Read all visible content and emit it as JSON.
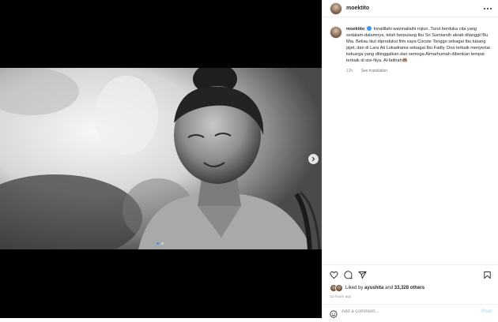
{
  "post": {
    "username": "moektito",
    "caption_username": "moektito",
    "caption_text": "Innalillahi wainnailaihi rojiun. Turut berduka cita yang sedalam-dalamnya, telah berpulang Ibu Sri Sumiarsih akrab dilanggil Bu Mia. Beliau ikut diproduksi film saya Cocote Tonggo sebagai Ibu tukang pijet, dan di Lara Ati Lokadrama sebagai Ibu Fadly. Doa terbaik menyertai keluarga yang ditinggalkan dan semoga Almarhumah dibenkan tempat terbaik di sisi-Nya. Al-fatihah🤲🏽",
    "caption_age": "12h",
    "see_translation": "See translation",
    "liked_by_prefix": "Liked by",
    "liked_by_user": "ayushita",
    "liked_by_and": "and",
    "liked_by_others": "33,328 others",
    "timestamp": "12 hours ago",
    "comment_placeholder": "Add a comment...",
    "post_label": "Post"
  },
  "carousel": {
    "slide_count": 2,
    "active_index": 0
  },
  "colors": {
    "accent": "#3897f0",
    "post_disabled": "#b2dffc",
    "muted": "#8e8e8e",
    "text": "#262626"
  },
  "icons": [
    "more-icon",
    "heart-icon",
    "comment-icon",
    "share-icon",
    "bookmark-icon",
    "emoji-icon",
    "chevron-right-icon",
    "verified-icon"
  ]
}
